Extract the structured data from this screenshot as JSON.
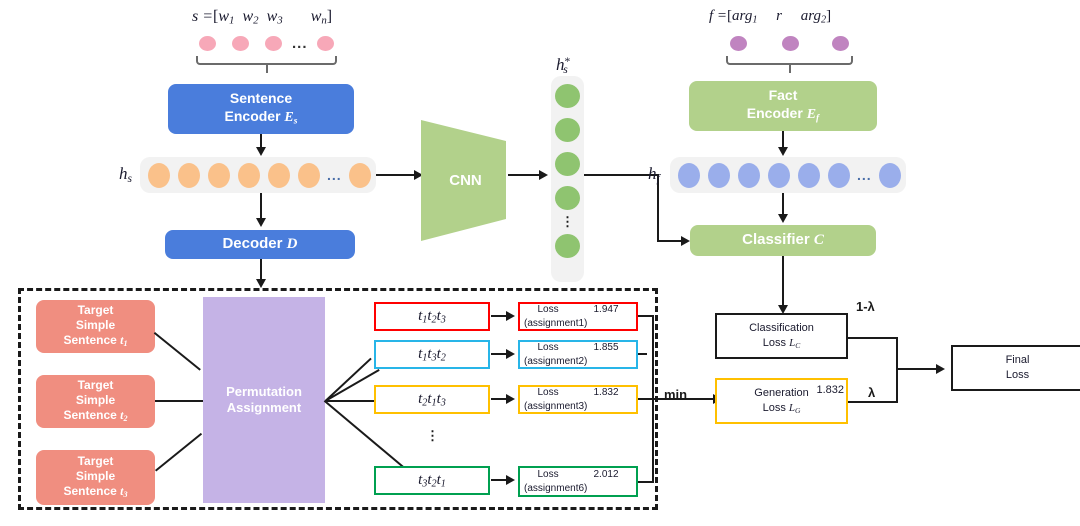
{
  "sentence_input": {
    "formula_prefix": "s =",
    "bracket_open": "[",
    "tokens": [
      "w",
      "w",
      "w",
      "w"
    ],
    "token_subs": [
      "1",
      "2",
      "3",
      "n"
    ],
    "ellipsis": "...",
    "bracket_close": "]",
    "dot_color": "#f7a8b8",
    "dot_count": 4
  },
  "fact_input": {
    "formula_prefix": "f =",
    "bracket_open": "[",
    "tokens": [
      "arg",
      "r",
      "arg"
    ],
    "token_subs": [
      "1",
      "",
      "2"
    ],
    "bracket_close": "]",
    "dot_color": "#c084c0",
    "dot_count": 3
  },
  "modules": {
    "sentence_encoder": {
      "line1": "Sentence",
      "line2": "Encoder",
      "symbol": "E",
      "symbol_sub": "s",
      "color": "#4a7ddc"
    },
    "fact_encoder": {
      "line1": "Fact",
      "line2": "Encoder",
      "symbol": "E",
      "symbol_sub": "f",
      "color": "#b2d18b"
    },
    "decoder": {
      "label": "Decoder",
      "symbol": "D",
      "color": "#4a7ddc"
    },
    "classifier": {
      "label": "Classifier",
      "symbol": "C",
      "color": "#b2d18b"
    },
    "cnn": {
      "label": "CNN",
      "color": "#b2d18b"
    },
    "permutation": {
      "line1": "Permutation",
      "line2": "Assignment",
      "color": "#c5b3e6"
    }
  },
  "hidden_states": {
    "hs": {
      "label": "h",
      "label_sub": "s",
      "dot_color": "#fac18a",
      "dot_count": 7,
      "ellipsis": "..."
    },
    "hs_star": {
      "label": "h",
      "label_sub": "s",
      "label_sup": "*",
      "dot_color": "#8fc470",
      "dot_count": 5,
      "ellipsis": "⋮"
    },
    "hf": {
      "label": "h",
      "label_sub": "f",
      "dot_color": "#9aaeeb",
      "dot_count": 7,
      "ellipsis": "..."
    }
  },
  "targets": [
    {
      "line1": "Target",
      "line2": "Simple",
      "line3": "Sentence",
      "symbol": "t",
      "symbol_sub": "1"
    },
    {
      "line1": "Target",
      "line2": "Simple",
      "line3": "Sentence",
      "symbol": "t",
      "symbol_sub": "2"
    },
    {
      "line1": "Target",
      "line2": "Simple",
      "line3": "Sentence",
      "symbol": "t",
      "symbol_sub": "3"
    }
  ],
  "permutations": [
    {
      "order": [
        "1",
        "2",
        "3"
      ],
      "color": "#ff0000",
      "loss_label": "Loss",
      "loss_value": "1.947",
      "assignment": "(assignment1)"
    },
    {
      "order": [
        "1",
        "3",
        "2"
      ],
      "color": "#28b5e8",
      "loss_label": "Loss",
      "loss_value": "1.855",
      "assignment": "(assignment2)"
    },
    {
      "order": [
        "2",
        "1",
        "3"
      ],
      "color": "#ffc000",
      "loss_label": "Loss",
      "loss_value": "1.832",
      "assignment": "(assignment3)"
    },
    {
      "order": [
        "3",
        "2",
        "1"
      ],
      "color": "#00a050",
      "loss_label": "Loss",
      "loss_value": "2.012",
      "assignment": "(assignment6)"
    }
  ],
  "permutation_ellipsis": "⋮",
  "min_label": "min",
  "losses": {
    "classification": {
      "line1": "Classification",
      "line2": "Loss",
      "symbol": "L",
      "symbol_sub": "C",
      "weight": "1-λ"
    },
    "generation": {
      "line1": "Generation",
      "line2": "Loss",
      "symbol": "L",
      "symbol_sub": "G",
      "value": "1.832",
      "weight": "λ",
      "border_color": "#ffc000"
    },
    "final": {
      "line1": "Final",
      "line2": "Loss"
    }
  }
}
